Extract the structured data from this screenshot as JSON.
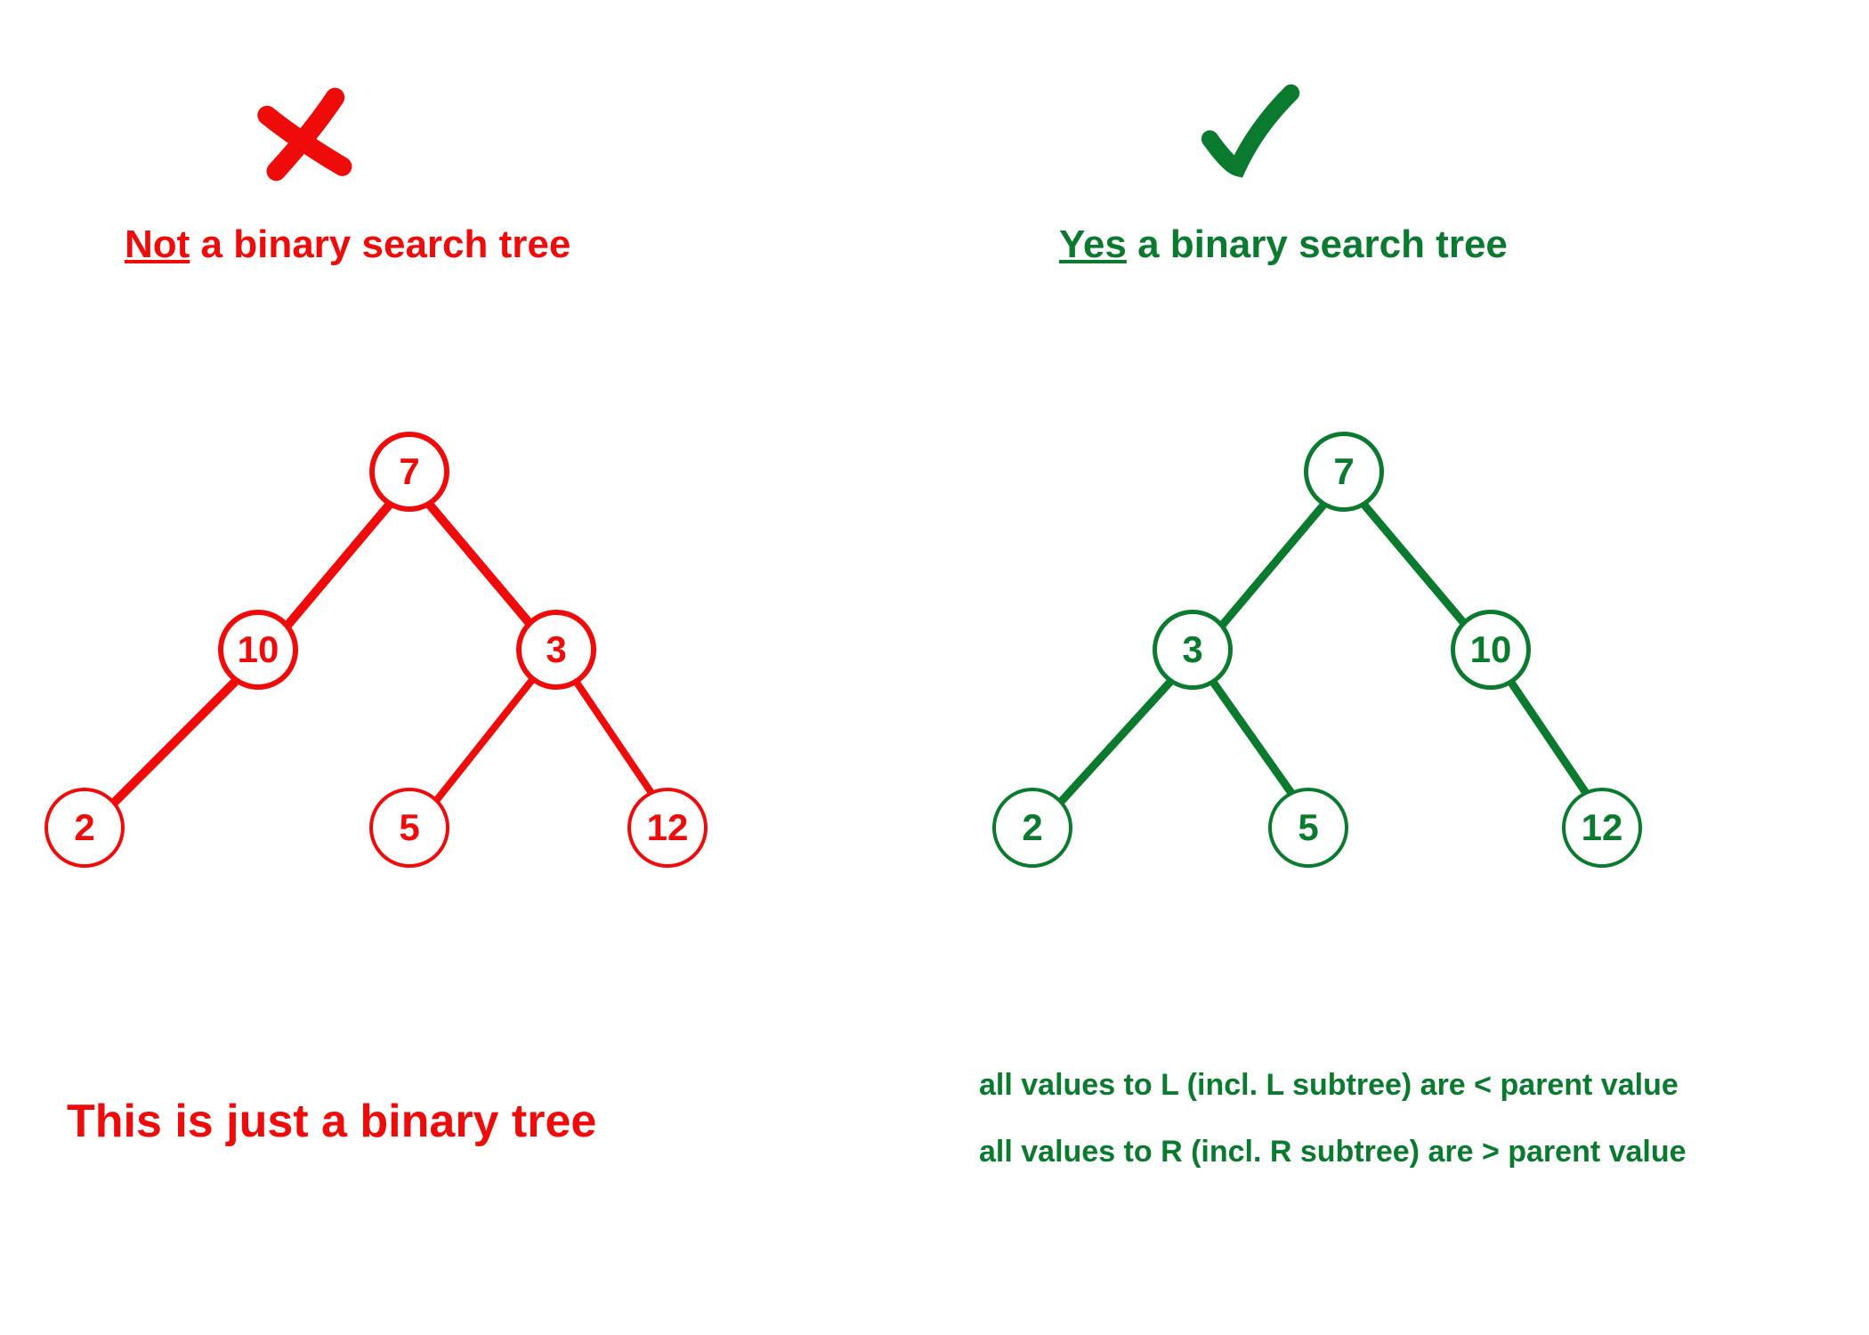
{
  "left": {
    "title_emph": "Not",
    "title_rest": " a binary search tree",
    "icon": "cross-icon",
    "color": "#f00b0b",
    "caption": "This is just a binary tree",
    "tree": {
      "root": "7",
      "l": "10",
      "r": "3",
      "ll": "2",
      "rl": "5",
      "rr": "12"
    }
  },
  "right": {
    "title_emph": "Yes",
    "title_rest": " a binary search tree",
    "icon": "check-icon",
    "color": "#0a7a2f",
    "caption": "",
    "rule1": "all  values to L (incl.  L subtree) are < parent value",
    "rule2": "all  values to R (incl.  R subtree) are > parent value",
    "tree": {
      "root": "7",
      "l": "3",
      "r": "10",
      "ll": "2",
      "lr": "5",
      "rr": "12"
    }
  },
  "chart_data": {
    "type": "tree",
    "trees": [
      {
        "label": "Not a binary search tree",
        "valid_bst": false,
        "color": "#f00b0b",
        "nodes": [
          {
            "id": "n1",
            "value": 7
          },
          {
            "id": "n2",
            "value": 10
          },
          {
            "id": "n3",
            "value": 3
          },
          {
            "id": "n4",
            "value": 2
          },
          {
            "id": "n5",
            "value": 5
          },
          {
            "id": "n6",
            "value": 12
          }
        ],
        "edges": [
          {
            "parent": "n1",
            "child": "n2",
            "side": "L"
          },
          {
            "parent": "n1",
            "child": "n3",
            "side": "R"
          },
          {
            "parent": "n2",
            "child": "n4",
            "side": "L"
          },
          {
            "parent": "n3",
            "child": "n5",
            "side": "L"
          },
          {
            "parent": "n3",
            "child": "n6",
            "side": "R"
          }
        ]
      },
      {
        "label": "Yes a binary search tree",
        "valid_bst": true,
        "color": "#0a7a2f",
        "nodes": [
          {
            "id": "m1",
            "value": 7
          },
          {
            "id": "m2",
            "value": 3
          },
          {
            "id": "m3",
            "value": 10
          },
          {
            "id": "m4",
            "value": 2
          },
          {
            "id": "m5",
            "value": 5
          },
          {
            "id": "m6",
            "value": 12
          }
        ],
        "edges": [
          {
            "parent": "m1",
            "child": "m2",
            "side": "L"
          },
          {
            "parent": "m1",
            "child": "m3",
            "side": "R"
          },
          {
            "parent": "m2",
            "child": "m4",
            "side": "L"
          },
          {
            "parent": "m2",
            "child": "m5",
            "side": "R"
          },
          {
            "parent": "m3",
            "child": "m6",
            "side": "R"
          }
        ]
      }
    ]
  }
}
